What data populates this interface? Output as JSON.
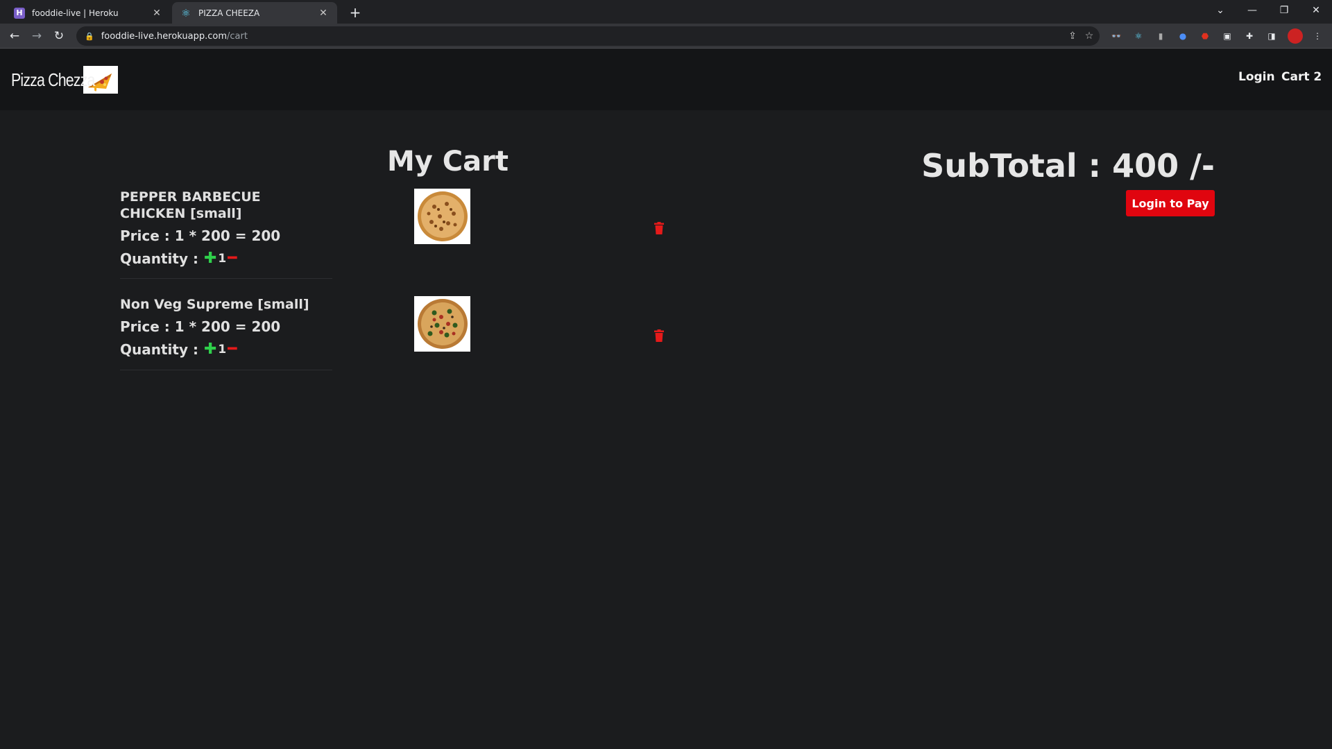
{
  "browser": {
    "tabs": [
      {
        "title": "fooddie-live | Heroku",
        "favicon": "heroku-icon",
        "active": false
      },
      {
        "title": "PIZZA CHEEZA",
        "favicon": "react-icon",
        "active": true
      }
    ],
    "url": {
      "host": "fooddie-live.herokuapp.com",
      "path": "/cart"
    }
  },
  "site": {
    "brand": "Pizza Chezza",
    "nav": {
      "login": "Login",
      "cart": "Cart 2"
    }
  },
  "cart": {
    "title": "My Cart",
    "items": [
      {
        "name": "PEPPER BARBECUE CHICKEN [small]",
        "price": "Price : 1 * 200 = 200",
        "quantity_label": "Quantity :",
        "quantity": "1",
        "pizza": "chicken"
      },
      {
        "name": "Non Veg Supreme [small]",
        "price": "Price : 1 * 200 = 200",
        "quantity_label": "Quantity :",
        "quantity": "1",
        "pizza": "supreme"
      }
    ],
    "subtotal": "SubTotal : 400 /-",
    "pay_button": "Login to Pay"
  },
  "colors": {
    "add": "#2fd04b",
    "remove": "#e51a1a",
    "pay": "#e0050f",
    "delete": "#e51a1a"
  }
}
